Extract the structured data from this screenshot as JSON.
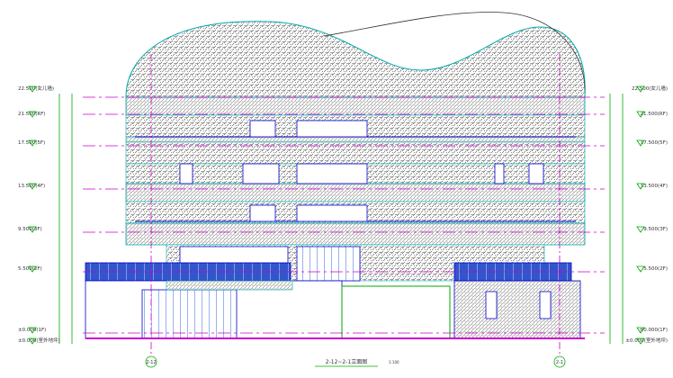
{
  "drawing": {
    "title": "2-12~2-1立面图",
    "scale": "1:100"
  },
  "levels": [
    {
      "label": "22.500(女儿墙)",
      "id": "parapet"
    },
    {
      "label": "21.500(RF)",
      "id": "rf"
    },
    {
      "label": "17.500(5F)",
      "id": "5f"
    },
    {
      "label": "13.500(4F)",
      "id": "4f"
    },
    {
      "label": "9.500(3F)",
      "id": "3f"
    },
    {
      "label": "5.500(2F)",
      "id": "2f"
    },
    {
      "label": "±0.000(1F)",
      "id": "1f"
    },
    {
      "label": "±0.000(室外地坪)",
      "id": "ground"
    }
  ],
  "axes": {
    "left": "2-12",
    "right": "2-1"
  },
  "colors": {
    "level_line": "#cc00cc",
    "dim_line": "#00aa00",
    "facade": "#00aaaa",
    "window": "#0000cc",
    "hatch": "#444444",
    "text": "#333333"
  }
}
